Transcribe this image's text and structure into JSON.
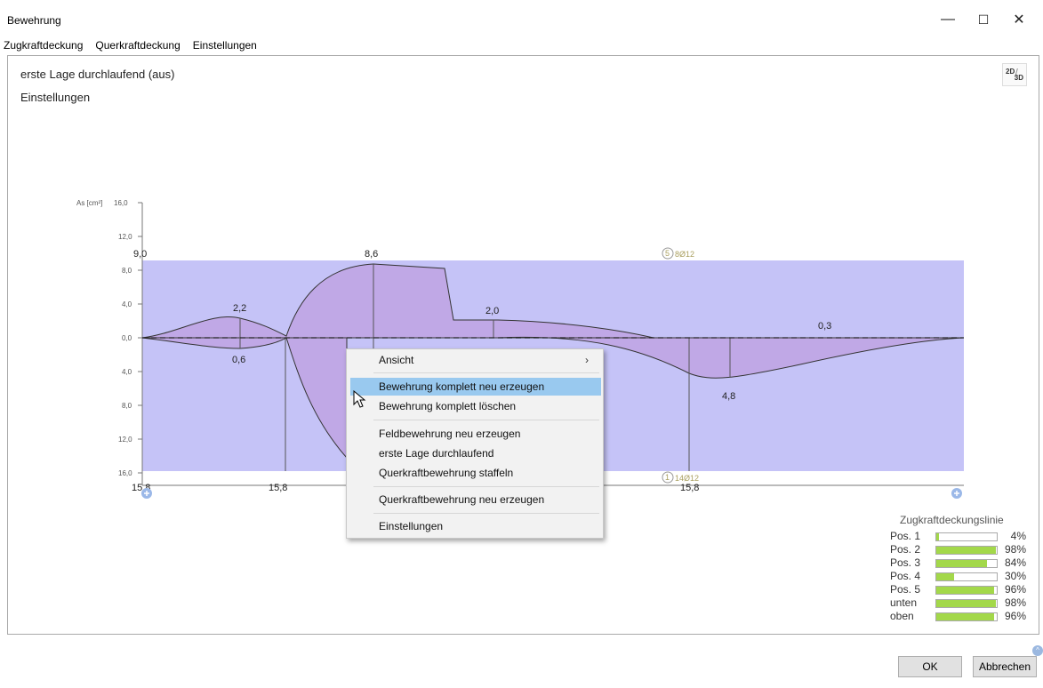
{
  "window": {
    "title": "Bewehrung",
    "minimize": "—",
    "maximize": "☐",
    "close": "✕"
  },
  "menu": [
    "Zugkraftdeckung",
    "Querkraftdeckung",
    "Einstellungen"
  ],
  "canvas": {
    "info_line1": "erste Lage durchlaufend (aus)",
    "info_line2": "Einstellungen",
    "toggle_2d": "2D",
    "toggle_3d": "3D"
  },
  "chart_data": {
    "type": "area",
    "ylabel": "As [cm²]",
    "y_ticks_upper": [
      "16,0",
      "12,0",
      "8,0",
      "4,0",
      "0,0"
    ],
    "y_ticks_lower": [
      "4,0",
      "8,0",
      "12,0",
      "16,0"
    ],
    "value_labels": [
      "9,0",
      "2,2",
      "0,6",
      "8,6",
      "2,0",
      "0,3",
      "4,8"
    ],
    "x_labels": [
      "15,8",
      "15,8",
      "15,8"
    ],
    "bar_annotations": [
      {
        "circle": "5",
        "text": "8Ø12"
      },
      {
        "circle": "1",
        "text": "14Ø12"
      }
    ],
    "colors": {
      "fill": "#c5c3f7",
      "curve_fill": "#c0a8e6"
    }
  },
  "context_menu": {
    "items": [
      {
        "label": "Ansicht",
        "submenu": true
      },
      {
        "label": "Bewehrung komplett neu erzeugen",
        "highlighted": true
      },
      {
        "label": "Bewehrung komplett löschen"
      },
      {
        "label": "Feldbewehrung neu erzeugen"
      },
      {
        "label": "erste Lage durchlaufend"
      },
      {
        "label": "Querkraftbewehrung staffeln"
      },
      {
        "label": "Querkraftbewehrung neu erzeugen"
      },
      {
        "label": "Einstellungen"
      }
    ],
    "submenu_arrow": "›"
  },
  "legend": {
    "title": "Zugkraftdeckungslinie",
    "rows": [
      {
        "label": "Pos. 1",
        "value": 4,
        "pct": "4%"
      },
      {
        "label": "Pos. 2",
        "value": 98,
        "pct": "98%"
      },
      {
        "label": "Pos. 3",
        "value": 84,
        "pct": "84%"
      },
      {
        "label": "Pos. 4",
        "value": 30,
        "pct": "30%"
      },
      {
        "label": "Pos. 5",
        "value": 96,
        "pct": "96%"
      },
      {
        "label": "unten",
        "value": 98,
        "pct": "98%"
      },
      {
        "label": "oben",
        "value": 96,
        "pct": "96%"
      }
    ]
  },
  "buttons": {
    "ok": "OK",
    "cancel": "Abbrechen"
  }
}
